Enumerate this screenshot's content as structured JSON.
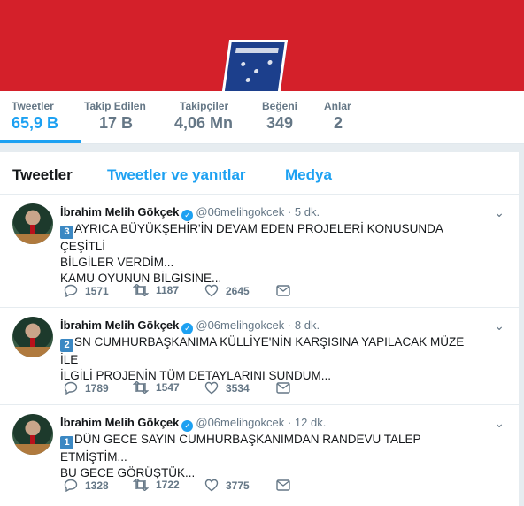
{
  "stats": [
    {
      "label": "Tweetler",
      "value": "65,9 B"
    },
    {
      "label": "Takip Edilen",
      "value": "17 B"
    },
    {
      "label": "Takipçiler",
      "value": "4,06 Mn"
    },
    {
      "label": "Beğeni",
      "value": "349"
    },
    {
      "label": "Anlar",
      "value": "2"
    }
  ],
  "tabs": [
    "Tweetler",
    "Tweetler ve yanıtlar",
    "Medya"
  ],
  "tweets": [
    {
      "name": "İbrahim Melih Gökçek",
      "handle": "@06melihgokcek",
      "sep": "·",
      "time": "5 dk.",
      "badge": "3",
      "line1": "AYRICA BÜYÜKŞEHİR'İN DEVAM EDEN PROJELERİ KONUSUNDA ÇEŞİTLİ",
      "line2": "BİLGİLER VERDİM...",
      "line3": "KAMU OYUNUN BİLGİSİNE...",
      "replies": "1571",
      "retweets": "1187",
      "likes": "2645"
    },
    {
      "name": "İbrahim Melih Gökçek",
      "handle": "@06melihgokcek",
      "sep": "·",
      "time": "8 dk.",
      "badge": "2",
      "line1": "SN CUMHURBAŞKANIMA KÜLLİYE'NİN KARŞISINA YAPILACAK MÜZE İLE",
      "line2": "İLGİLİ PROJENİN TÜM DETAYLARINI SUNDUM...",
      "line3": "",
      "replies": "1789",
      "retweets": "1547",
      "likes": "3534"
    },
    {
      "name": "İbrahim Melih Gökçek",
      "handle": "@06melihgokcek",
      "sep": "·",
      "time": "12 dk.",
      "badge": "1",
      "line1": "DÜN GECE SAYIN CUMHURBAŞKANIMDAN RANDEVU TALEP ETMİŞTİM...",
      "line2": "BU GECE GÖRÜŞTÜK...",
      "line3": "",
      "replies": "1328",
      "retweets": "1722",
      "likes": "3775"
    }
  ],
  "colors": {
    "banner": "#d4202a",
    "accent": "#1da1f2",
    "muted": "#657786"
  }
}
